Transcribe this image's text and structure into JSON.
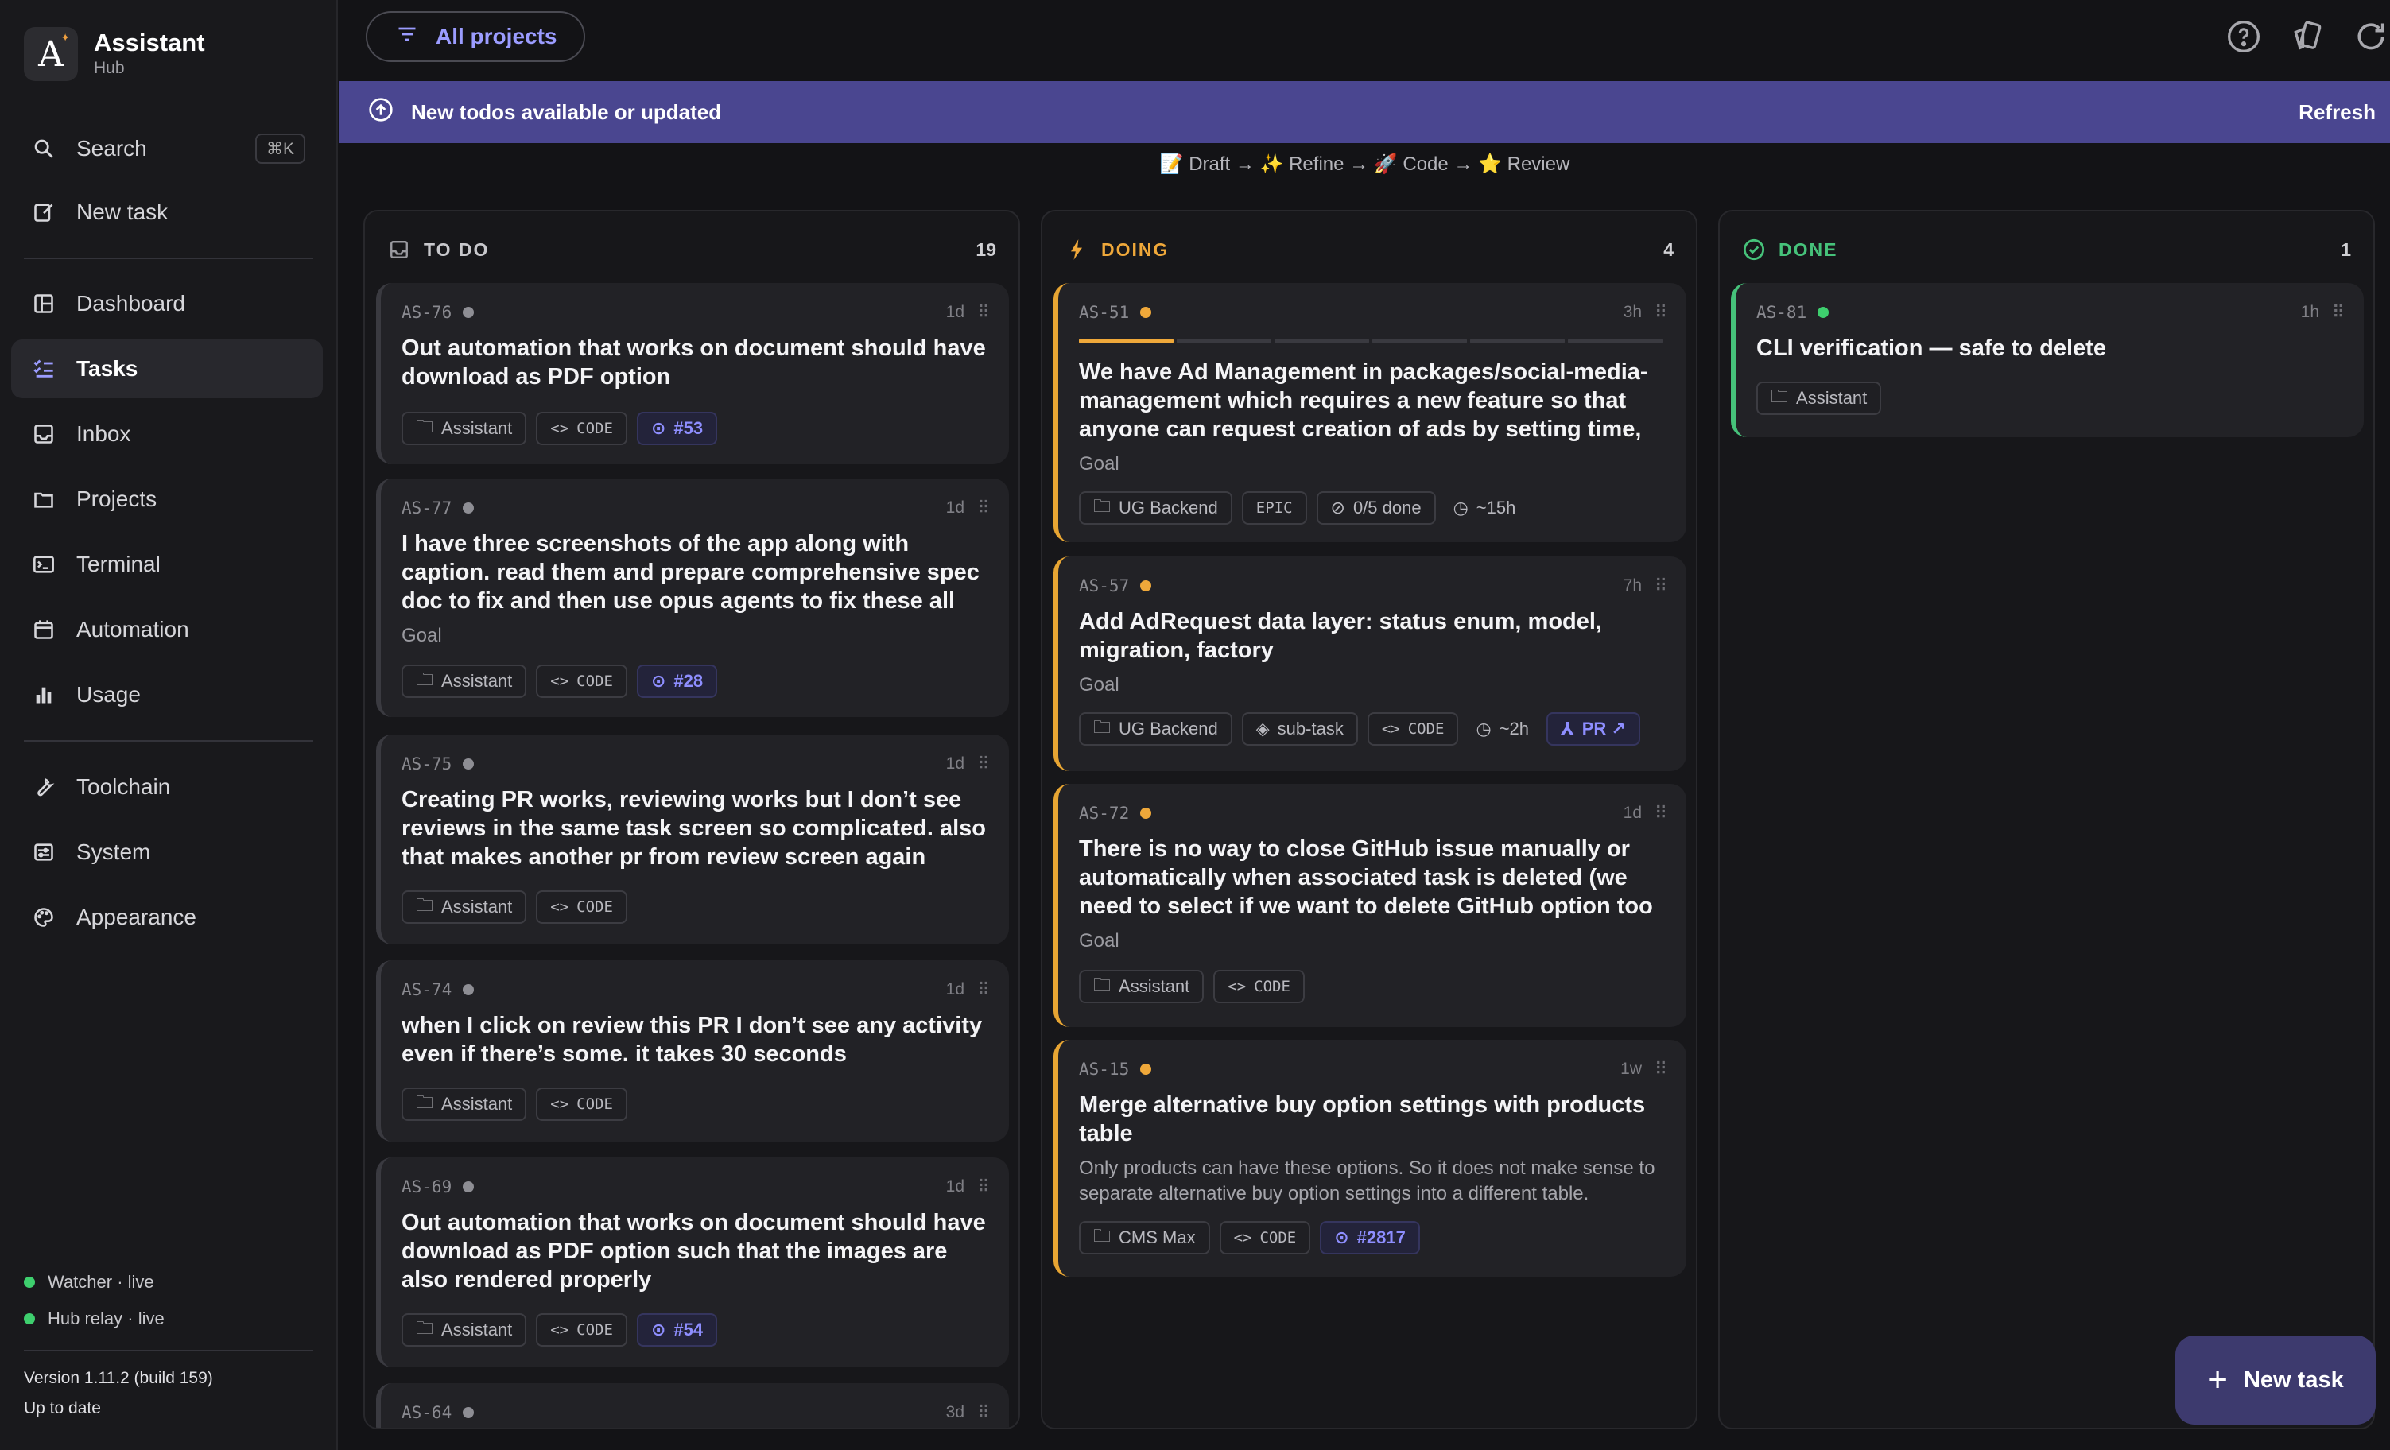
{
  "app": {
    "name": "Assistant",
    "subtitle": "Hub",
    "logo_letter": "A"
  },
  "sidebar": {
    "search_label": "Search",
    "search_shortcut": "⌘K",
    "new_task_label": "New task",
    "items": [
      {
        "label": "Dashboard",
        "icon": "dashboard-icon"
      },
      {
        "label": "Tasks",
        "icon": "tasks-icon",
        "active": true
      },
      {
        "label": "Inbox",
        "icon": "inbox-icon"
      },
      {
        "label": "Projects",
        "icon": "folder-icon"
      },
      {
        "label": "Terminal",
        "icon": "terminal-icon"
      },
      {
        "label": "Automation",
        "icon": "calendar-icon"
      },
      {
        "label": "Usage",
        "icon": "bar-chart-icon"
      }
    ],
    "items2": [
      {
        "label": "Toolchain",
        "icon": "wrench-icon"
      },
      {
        "label": "System",
        "icon": "sliders-icon"
      },
      {
        "label": "Appearance",
        "icon": "palette-icon"
      }
    ],
    "status": {
      "watcher": "Watcher · live",
      "relay": "Hub relay · live"
    },
    "version": "Version 1.11.2 (build 159)",
    "update_status": "Up to date"
  },
  "topbar": {
    "filter_label": "All projects"
  },
  "banner": {
    "text": "New todos available or updated",
    "action": "Refresh"
  },
  "workflow": "📝 Draft → ✨ Refine → 🚀 Code → ⭐ Review",
  "colors": {
    "accent": "#9b9cff",
    "todo": "#c8c8cc",
    "doing": "#efa83a",
    "done": "#46c27a",
    "banner": "#4a4690"
  },
  "columns": {
    "todo": {
      "title": "TO DO",
      "count": "19"
    },
    "doing": {
      "title": "DOING",
      "count": "4"
    },
    "done": {
      "title": "DONE",
      "count": "1"
    }
  },
  "todo_cards": [
    {
      "id": "AS-76",
      "age": "1d",
      "title": "Out automation that works on document should have download as PDF option",
      "project": "Assistant",
      "type": "CODE",
      "issue": "#53"
    },
    {
      "id": "AS-77",
      "age": "1d",
      "title": "I have three screenshots of the app along with caption. read them and prepare comprehensive spec doc to fix and then use opus agents to fix these all",
      "goal": "Goal",
      "project": "Assistant",
      "type": "CODE",
      "issue": "#28"
    },
    {
      "id": "AS-75",
      "age": "1d",
      "title": "Creating PR works, reviewing works but I don’t see reviews in the same task screen so complicated. also that makes another pr from review screen again",
      "project": "Assistant",
      "type": "CODE"
    },
    {
      "id": "AS-74",
      "age": "1d",
      "title": "when I click on review this PR I don’t see any activity even if there’s some. it takes 30 seconds",
      "project": "Assistant",
      "type": "CODE"
    },
    {
      "id": "AS-69",
      "age": "1d",
      "title": "Out automation that works on document should have download as PDF option such that the images are also rendered properly",
      "project": "Assistant",
      "type": "CODE",
      "issue": "#54"
    },
    {
      "id": "AS-64",
      "age": "3d"
    }
  ],
  "doing_cards": [
    {
      "id": "AS-51",
      "age": "3h",
      "title": "We have Ad Management in packages/social-media-management which requires a new feature so that anyone can request creation of ads by setting time, bu…",
      "goal": "Goal",
      "project": "UG Backend",
      "kind": "EPIC",
      "progress": "0/5 done",
      "estimate": "~15h"
    },
    {
      "id": "AS-57",
      "age": "7h",
      "title": "Add AdRequest data layer: status enum, model, migration, factory",
      "goal": "Goal",
      "project": "UG Backend",
      "kind": "sub-task",
      "type": "CODE",
      "estimate": "~2h",
      "pr": "PR ↗"
    },
    {
      "id": "AS-72",
      "age": "1d",
      "title": "There is no way to close GitHub issue manually or automatically when associated task is deleted (we need to select if we want to delete GitHub option too while d…",
      "goal": "Goal",
      "project": "Assistant",
      "type": "CODE"
    },
    {
      "id": "AS-15",
      "age": "1w",
      "title": "Merge alternative buy option settings with products table",
      "desc": "Only products can have these options. So it does not make sense to separate alternative buy option settings into a different table.",
      "project": "CMS Max",
      "type": "CODE",
      "issue": "#2817"
    }
  ],
  "done_cards": [
    {
      "id": "AS-81",
      "age": "1h",
      "title": "CLI verification — safe to delete",
      "project": "Assistant"
    }
  ],
  "fab": {
    "label": "New task"
  }
}
